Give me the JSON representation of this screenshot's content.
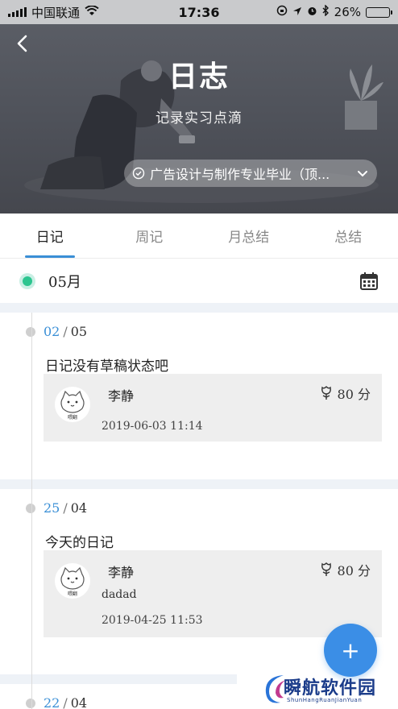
{
  "status_bar": {
    "carrier": "中国联通",
    "time": "17:36",
    "battery_percent": "26%",
    "battery_level": 0.26
  },
  "header": {
    "title": "日志",
    "subtitle": "记录实习点滴",
    "plan_select": "广告设计与制作专业毕业（顶..."
  },
  "tabs": [
    {
      "label": "日记",
      "active": true
    },
    {
      "label": "周记",
      "active": false
    },
    {
      "label": "月总结",
      "active": false
    },
    {
      "label": "总结",
      "active": false
    }
  ],
  "month": {
    "label": "05月"
  },
  "entries": [
    {
      "day": "02",
      "month": "05",
      "sep": "/",
      "title": "日记没有草稿状态吧",
      "author": "李静",
      "score": "80 分",
      "content": "",
      "time": "2019-06-03 11:14",
      "avatar_text": "喂翻"
    },
    {
      "day": "25",
      "month": "04",
      "sep": "/",
      "title": "今天的日记",
      "author": "李静",
      "score": "80 分",
      "content": "dadad",
      "time": "2019-04-25 11:53",
      "avatar_text": "喂翻"
    },
    {
      "day": "22",
      "month": "04",
      "sep": "/"
    }
  ],
  "fab": {
    "label": "+"
  },
  "watermark": {
    "cn": "瞬航软件园",
    "en": "ShunHangRuanJianYuan"
  },
  "colors": {
    "accent": "#3a8fd6",
    "fab": "#3b8ee6",
    "month_dot": "#2cc58f",
    "section_gap": "#eef2f7",
    "card_bg": "#eeeeee"
  }
}
